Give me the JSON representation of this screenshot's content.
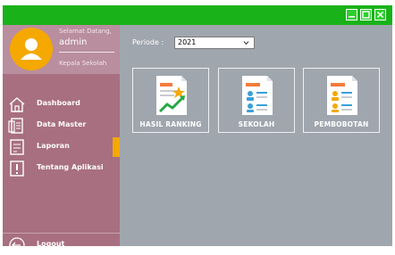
{
  "window": {
    "controls": [
      {
        "name": "minimize-button",
        "icon": "minimize-icon"
      },
      {
        "name": "maximize-button",
        "icon": "maximize-icon"
      },
      {
        "name": "close-button",
        "icon": "close-icon"
      }
    ]
  },
  "user": {
    "greeting": "Selamat Datang,",
    "name": "admin",
    "role": "Kepala Sekolah",
    "avatar_icon": "user-avatar-icon"
  },
  "sidebar": {
    "items": [
      {
        "label": "Dashboard",
        "icon": "home-icon"
      },
      {
        "label": "Data Master",
        "icon": "document-icon"
      },
      {
        "label": "Laporan",
        "icon": "report-icon",
        "active": true
      },
      {
        "label": "Tentang Aplikasi",
        "icon": "info-icon"
      }
    ],
    "logout": {
      "label": "Logout",
      "icon": "logout-icon"
    }
  },
  "filter": {
    "label": "Periode :",
    "selected": "2021"
  },
  "tiles": [
    {
      "label": "HASIL RANKING",
      "icon": "ranking-chart-icon"
    },
    {
      "label": "SEKOLAH",
      "icon": "school-report-icon"
    },
    {
      "label": "PEMBOBOTAN",
      "icon": "weighting-report-icon"
    }
  ],
  "colors": {
    "titlebar": "#19b219",
    "sidebar": "#a86f80",
    "content": "#a0a6ae",
    "accent": "#f4a800"
  }
}
